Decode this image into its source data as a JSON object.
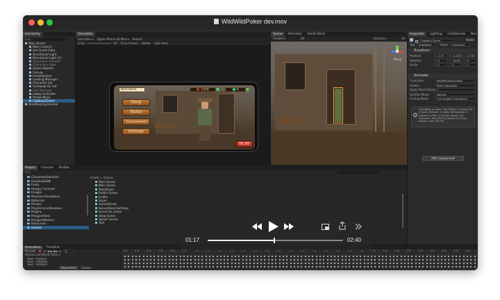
{
  "window": {
    "title": "WildWildPoker dev.mov"
  },
  "hierarchy": {
    "tabs": [
      "Hierarchy"
    ],
    "items": [
      {
        "label": "Main Scene",
        "indent": 0,
        "selected": false,
        "dim": false
      },
      {
        "label": "Main Camera",
        "indent": 1,
        "selected": false,
        "dim": false
      },
      {
        "label": "Get Guest Data",
        "indent": 1,
        "selected": false,
        "dim": false
      },
      {
        "label": "Directional Light",
        "indent": 1,
        "selected": false,
        "dim": false
      },
      {
        "label": "Directional Light (1)",
        "indent": 1,
        "selected": false,
        "dim": false
      },
      {
        "label": "Characters Female",
        "indent": 1,
        "selected": false,
        "dim": true
      },
      {
        "label": "Characters Male",
        "indent": 1,
        "selected": false,
        "dim": true
      },
      {
        "label": "Scene Objects",
        "indent": 1,
        "selected": false,
        "dim": false
      },
      {
        "label": "Canvas",
        "indent": 1,
        "selected": false,
        "dim": false
      },
      {
        "label": "EventSystem",
        "indent": 1,
        "selected": false,
        "dim": false
      },
      {
        "label": "Loading Manager",
        "indent": 1,
        "selected": false,
        "dim": false
      },
      {
        "label": "Character list",
        "indent": 1,
        "selected": false,
        "dim": false
      },
      {
        "label": "Facebook for Init",
        "indent": 1,
        "selected": false,
        "dim": false
      },
      {
        "label": "Link Manager",
        "indent": 1,
        "selected": false,
        "dim": true
      },
      {
        "label": "LobbyController",
        "indent": 1,
        "selected": false,
        "dim": false
      },
      {
        "label": "PhotonMono",
        "indent": 1,
        "selected": false,
        "dim": false
      },
      {
        "label": "Cowboy(Clone)",
        "indent": 1,
        "selected": true,
        "dim": false
      },
      {
        "label": "DontDestroyOnLoad",
        "indent": 0,
        "selected": false,
        "dim": false
      }
    ]
  },
  "game": {
    "tab": "Simulator",
    "device": "Apple iPhone XS Max",
    "reload": "Reload",
    "scale_label": "Scale",
    "scale_value": "26",
    "fit": "Fit to Screen",
    "rotate": "Rotate",
    "safe_area": "Safe Area",
    "hud": {
      "nickname": "Nickname",
      "chips": "1500",
      "gems": "0",
      "menu": [
        "Shop",
        "Rules",
        "Tournament",
        "Settings"
      ],
      "play": "PLAY"
    }
  },
  "scene_view": {
    "tabs": [
      "Scene",
      "Animator",
      "Asset Store"
    ],
    "shading": "Shaded",
    "twod": "2D",
    "gizmos": "Gizmos",
    "search": "All",
    "persp": "Persp"
  },
  "inspector": {
    "tabs": [
      "Inspector",
      "Lighting",
      "Collaborate",
      "Nav"
    ],
    "object_name": "Cowboy(Clone)",
    "static": "Static",
    "tag_label": "Tag",
    "tag": "Untagged",
    "layer_label": "Layer",
    "layer": "Character",
    "transform": {
      "title": "Transform",
      "rows": [
        {
          "label": "Position",
          "x": "-5.9",
          "y": "-0.033",
          "z": "17.09"
        },
        {
          "label": "Rotation",
          "x": "0",
          "y": "163.8",
          "z": "0"
        },
        {
          "label": "Scale",
          "x": "1",
          "y": "1",
          "z": "1"
        }
      ]
    },
    "animator": {
      "title": "Animator",
      "rows": [
        {
          "label": "Controller",
          "value": "MaleMainMenuPose"
        },
        {
          "label": "Avatar",
          "value": "Male IdleAvatar"
        },
        {
          "label": "Apply Root Motion",
          "value": "✓"
        },
        {
          "label": "Update Mode",
          "value": "Normal"
        },
        {
          "label": "Culling Mode",
          "value": "Cull Update Transforms"
        }
      ],
      "info": "Animation is clean. Clip Count: 1 Curves Pos: 0 Quat: 38 Euler: 0 Scale: 38 Muscles: 0 Generic: 0 PPtr: 0 Curves Count: 114 Constant: 106 (76.3%) Dense: 8 (5.3%) Stream: 126 (76.7%)"
    },
    "add_component": "Add Component"
  },
  "project": {
    "tabs": [
      "Project",
      "Console",
      "Profiler"
    ],
    "folders": [
      "CharacterSelection",
      "FacebookSDK",
      "Fonts",
      "Hungry Carnival",
      "Images",
      "Mixamo Animations",
      "Materials",
      "Photon",
      "PlayServicesResolver",
      "Plugins",
      "PolygonHeist",
      "PolygonWestern",
      "Resources",
      "Scenes"
    ],
    "breadcrumb": "Assets > Scenes",
    "files": [
      "Main Scene",
      "Main Scene",
      "MainRoom",
      "Profile Scene",
      "Profile",
      "Room",
      "SaloonRoom",
      "SaloonRoomSettings",
      "Scene for photo",
      "Shop Scene",
      "Splash Scene",
      "Test"
    ]
  },
  "animation": {
    "tabs": [
      "Animation",
      "Timeline"
    ],
    "preview": "Preview",
    "frame": "0",
    "clip": "Heroes.com(Read Only)",
    "tracks": [
      "Root : Position",
      "Root : Rotation",
      "Hips : Rotation"
    ],
    "footer": [
      "Dopesheet",
      "Curves"
    ],
    "ticks": [
      "0:00",
      "0:10",
      "0:20",
      "0:30",
      "0:40",
      "0:50",
      "1:00",
      "1:10",
      "1:20",
      "1:30",
      "1:40",
      "1:50",
      "2:00",
      "2:10",
      "2:20",
      "2:30",
      "2:40",
      "2:50",
      "3:00",
      "3:10",
      "3:20",
      "3:30",
      "3:40",
      "3:50",
      "4:00",
      "4:10",
      "4:20",
      "4:30",
      "4:40",
      "4:50"
    ]
  },
  "player": {
    "elapsed": "01:17",
    "total": "02:40",
    "progress": 0.49
  }
}
